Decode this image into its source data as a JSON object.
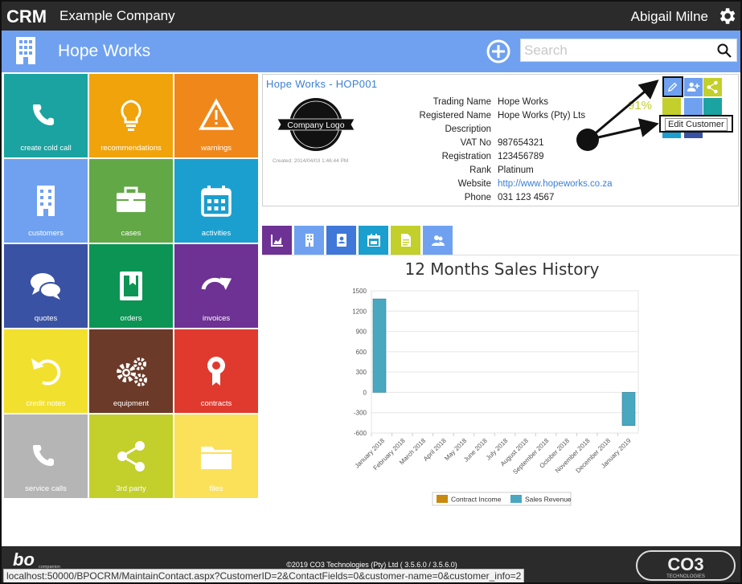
{
  "app": {
    "logo_text": "CRM",
    "company": "Example Company",
    "user_name": "Abigail Milne"
  },
  "titlebar": {
    "title": "Hope Works",
    "search_placeholder": "Search"
  },
  "tiles": [
    {
      "label": "create cold call",
      "icon": "phone-icon",
      "color": "#1aa3a0"
    },
    {
      "label": "recommendations",
      "icon": "lightbulb-icon",
      "color": "#f0a30a"
    },
    {
      "label": "warnings",
      "icon": "warning-icon",
      "color": "#f0871a"
    },
    {
      "label": "customers",
      "icon": "building-icon",
      "color": "#6fa1f0"
    },
    {
      "label": "cases",
      "icon": "briefcase-icon",
      "color": "#62a847"
    },
    {
      "label": "activities",
      "icon": "calendar-icon",
      "color": "#1b9fce"
    },
    {
      "label": "quotes",
      "icon": "chat-icon",
      "color": "#3a52a3"
    },
    {
      "label": "orders",
      "icon": "book-icon",
      "color": "#0c9455"
    },
    {
      "label": "invoices",
      "icon": "arrow-redo-icon",
      "color": "#6e3194"
    },
    {
      "label": "credit notes",
      "icon": "undo-icon",
      "color": "#f2e02e"
    },
    {
      "label": "equipment",
      "icon": "gears-icon",
      "color": "#6b3a28"
    },
    {
      "label": "contracts",
      "icon": "award-icon",
      "color": "#e03a2f"
    },
    {
      "label": "service calls",
      "icon": "phone-icon",
      "color": "#b5b5b5"
    },
    {
      "label": "3rd party",
      "icon": "share-icon",
      "color": "#c3cf2b"
    },
    {
      "label": "files",
      "icon": "folder-icon",
      "color": "#fbe15a"
    }
  ],
  "customer": {
    "heading": "Hope Works - HOP001",
    "logo_text": "Company Logo",
    "created": "Created: 2014/04/03 1:46:44 PM",
    "fields": [
      {
        "key": "Trading Name",
        "value": "Hope Works"
      },
      {
        "key": "Registered Name",
        "value": "Hope Works (Pty) Lts"
      },
      {
        "key": "Description",
        "value": ""
      },
      {
        "key": "VAT No",
        "value": "987654321"
      },
      {
        "key": "Registration",
        "value": "123456789"
      },
      {
        "key": "Rank",
        "value": "Platinum"
      },
      {
        "key": "Website",
        "value": "http://www.hopeworks.co.za"
      },
      {
        "key": "Phone",
        "value": "031 123 4567"
      }
    ],
    "percent": "91%",
    "tooltip": "Edit Customer"
  },
  "tabs": [
    {
      "icon": "area-chart-icon",
      "color": "#6e3194"
    },
    {
      "icon": "building-icon",
      "color": "#6fa1f0"
    },
    {
      "icon": "address-book-icon",
      "color": "#3f78d8"
    },
    {
      "icon": "calendar-icon",
      "color": "#1b9fce"
    },
    {
      "icon": "document-icon",
      "color": "#c3cf2b"
    },
    {
      "icon": "contacts-icon",
      "color": "#6fa1f0"
    }
  ],
  "chart_data": {
    "type": "bar",
    "title": "12 Months Sales History",
    "categories": [
      "January 2018",
      "February 2018",
      "March 2018",
      "April 2018",
      "May 2018",
      "June 2018",
      "July 2018",
      "August 2018",
      "September 2018",
      "October 2018",
      "November 2018",
      "December 2018",
      "January 2019"
    ],
    "series": [
      {
        "name": "Contract Income",
        "color": "#c9880e",
        "values": [
          0,
          0,
          0,
          0,
          0,
          0,
          0,
          0,
          0,
          0,
          0,
          0,
          0
        ]
      },
      {
        "name": "Sales Revenue",
        "color": "#4aa7c0",
        "values": [
          1380,
          0,
          0,
          0,
          0,
          0,
          0,
          0,
          0,
          0,
          0,
          0,
          -490
        ]
      }
    ],
    "yticks": [
      "1500",
      "1200",
      "900",
      "600",
      "300",
      "0",
      "-300",
      "-600"
    ],
    "ylim": [
      -600,
      1500
    ],
    "legend_position": "bottom"
  },
  "footer": {
    "brand_left": "bo",
    "brand_left_sub": "companion",
    "copyright": "©2019 CO3 Technologies (Pty) Ltd ( 3.5.6.0 / 3.5.6.0)",
    "brand_right": "CO3",
    "brand_right_sub": "TECHNOLOGIES"
  },
  "statusbar": {
    "url": "localhost:50000/BPOCRM/MaintainContact.aspx?CustomerID=2&ContactFields=0&customer-name=0&customer_info=2"
  }
}
